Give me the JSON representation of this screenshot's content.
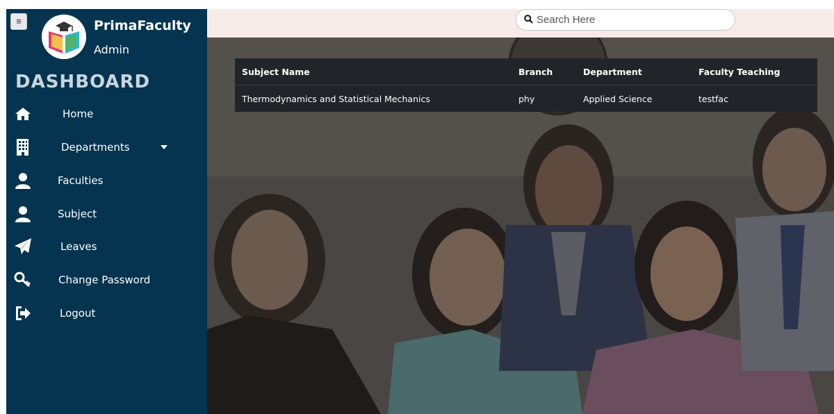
{
  "sidebar": {
    "menu_icon": "hamburger-icon",
    "brand": "PrimaFaculty",
    "role": "Admin",
    "heading": "DASHBOARD",
    "items": [
      {
        "label": "Home",
        "icon": "home-icon"
      },
      {
        "label": "Departments",
        "icon": "building-icon"
      },
      {
        "label": "Faculties",
        "icon": "user-icon"
      },
      {
        "label": "Subject",
        "icon": "user-icon"
      },
      {
        "label": "Leaves",
        "icon": "paper-plane-icon"
      },
      {
        "label": "Change Password",
        "icon": "key-icon"
      },
      {
        "label": "Logout",
        "icon": "sign-out-icon"
      }
    ]
  },
  "search": {
    "placeholder": "Search Here",
    "value": ""
  },
  "table": {
    "headers": [
      "Subject Name",
      "Branch",
      "Department",
      "Faculty Teaching"
    ],
    "rows": [
      [
        "Thermodynamics and Statistical Mechanics",
        "phy",
        "Applied Science",
        "testfac"
      ]
    ]
  },
  "colors": {
    "sidebar": "#04344f",
    "topbar": "#f7ebea",
    "table": "#212529"
  }
}
